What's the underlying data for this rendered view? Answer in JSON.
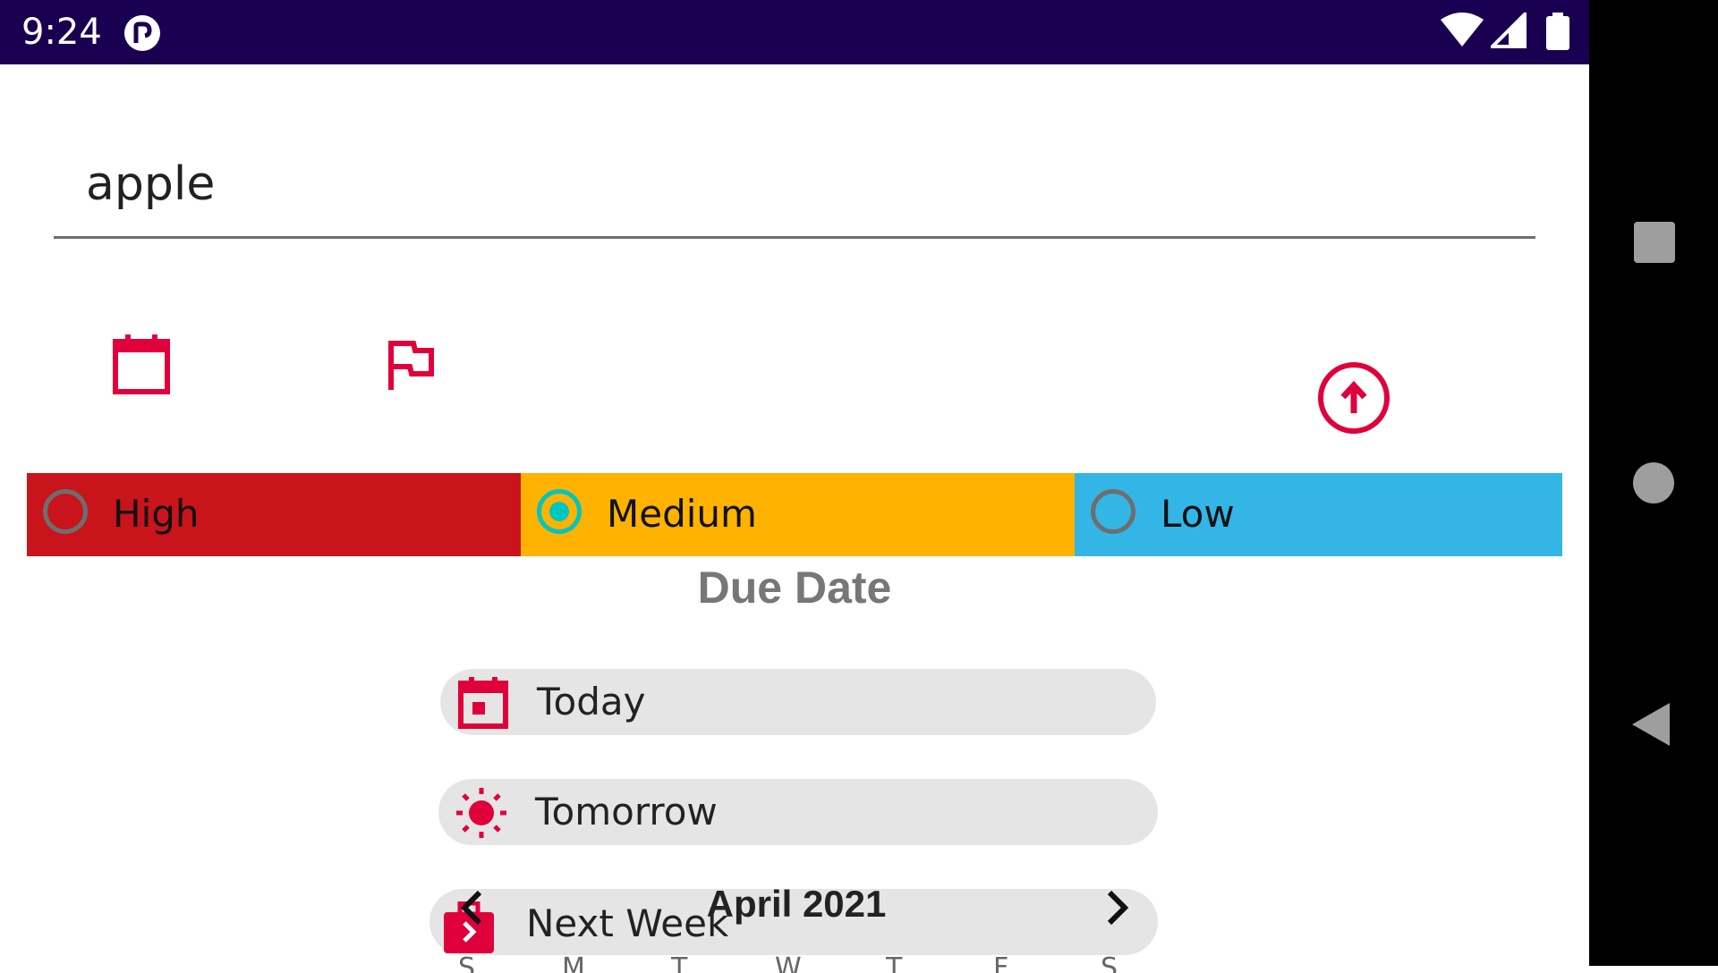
{
  "status_bar": {
    "time": "9:24",
    "app_icon": "notification-app-icon",
    "icons": [
      "wifi-icon",
      "cell-signal-icon",
      "battery-icon"
    ]
  },
  "task_input": {
    "value": "apple"
  },
  "toolbar": {
    "icons": [
      "calendar-icon",
      "flag-icon",
      "send-up-arrow-icon"
    ],
    "accent_color": "#e0003b"
  },
  "priority": {
    "options": [
      {
        "label": "High",
        "color": "#c8141a",
        "selected": false
      },
      {
        "label": "Medium",
        "color": "#ffb300",
        "selected": true
      },
      {
        "label": "Low",
        "color": "#33b5e5",
        "selected": false
      }
    ]
  },
  "due_date": {
    "title": "Due Date",
    "quick_options": [
      {
        "label": "Today",
        "icon": "calendar-today-icon"
      },
      {
        "label": "Tomorrow",
        "icon": "sun-icon"
      },
      {
        "label": "Next Week",
        "icon": "briefcase-arrow-icon"
      }
    ]
  },
  "calendar": {
    "month": "April 2021",
    "prev_icon": "chevron-left-icon",
    "next_icon": "chevron-right-icon",
    "weekdays": [
      "S",
      "M",
      "T",
      "W",
      "T",
      "F",
      "S"
    ]
  },
  "nav_bar": {
    "buttons": [
      "recents-square-icon",
      "home-circle-icon",
      "back-triangle-icon"
    ]
  }
}
